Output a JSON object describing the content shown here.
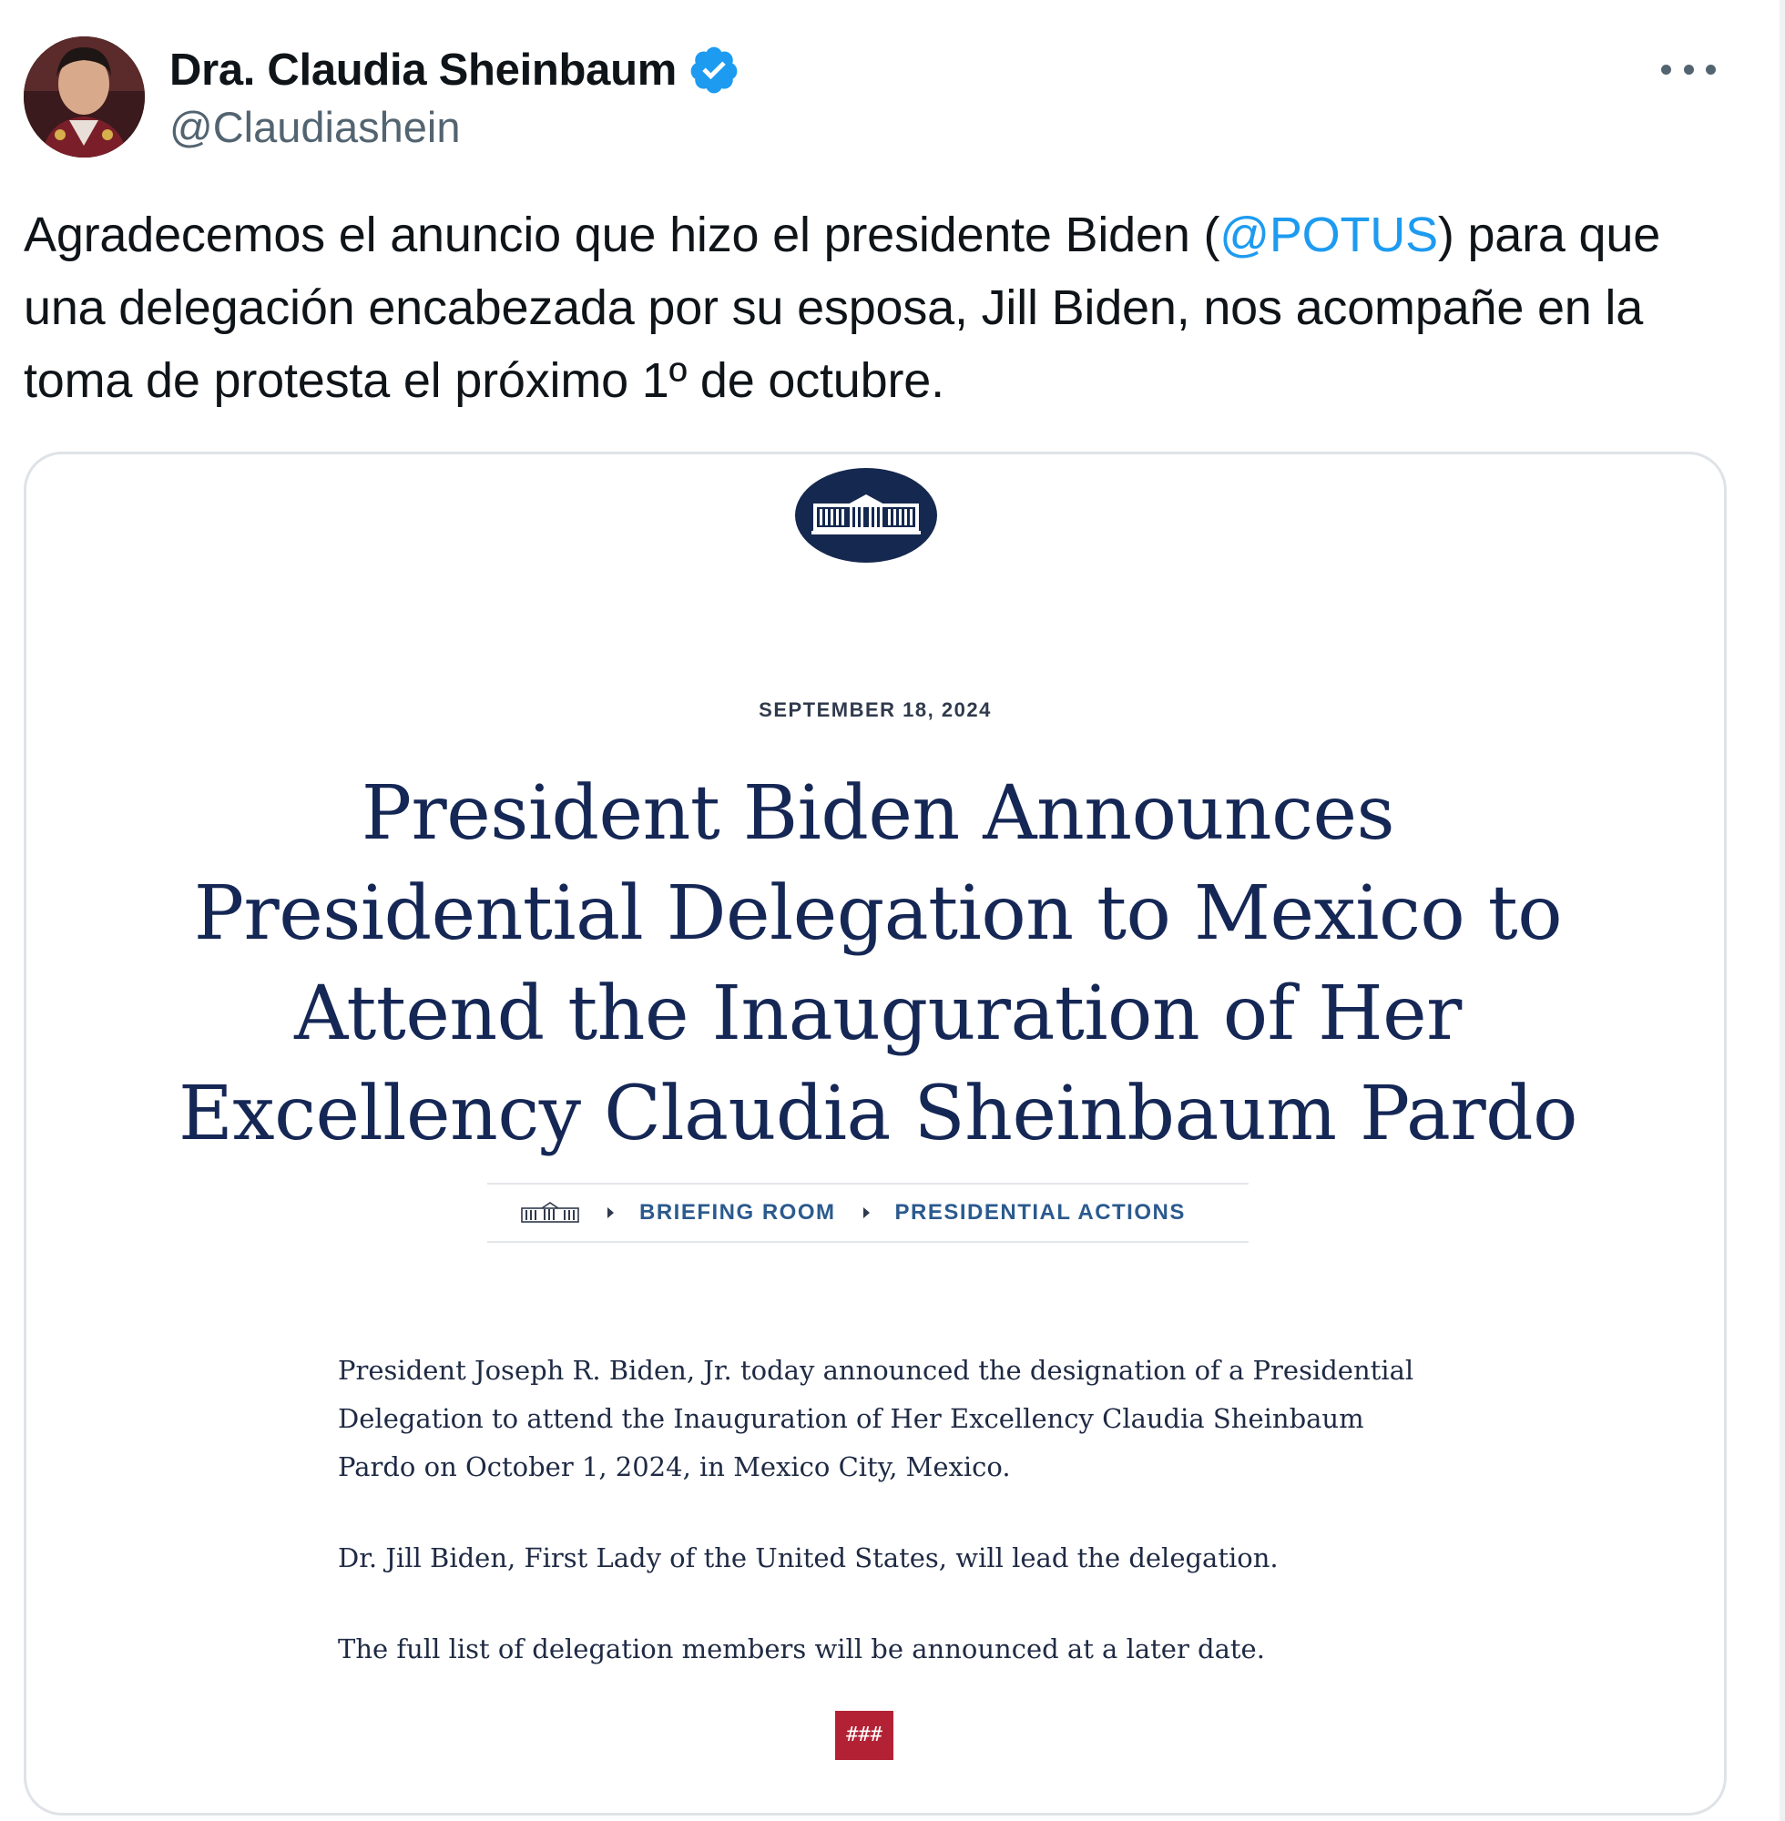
{
  "tweet": {
    "author": {
      "display_name": "Dra. Claudia Sheinbaum",
      "handle": "@Claudiashein",
      "verified": true
    },
    "text": {
      "before_mention": "Agradecemos el anuncio que hizo el presidente Biden (",
      "mention": "@POTUS",
      "after_mention": ") para que una delegación encabezada por su esposa, Jill Biden, nos acompañe en la toma de protesta el próximo 1º de octubre."
    },
    "icons": {
      "more": "more-horizontal-icon",
      "verified": "verified-badge-icon"
    }
  },
  "press_release": {
    "date": "SEPTEMBER 18, 2024",
    "title": "President Biden Announces Presidential Delegation to Mexico to Attend the Inauguration of Her Excellency Claudia Sheinbaum Pardo",
    "breadcrumb": [
      "BRIEFING ROOM",
      "PRESIDENTIAL ACTIONS"
    ],
    "paragraphs": [
      "President Joseph R. Biden, Jr. today announced the designation of a Presidential Delegation to attend the Inauguration of Her Excellency Claudia Sheinbaum Pardo on October 1, 2024, in Mexico City, Mexico.",
      "Dr. Jill Biden, First Lady of the United States, will lead the delegation.",
      "The full list of delegation members will be announced at a later date."
    ],
    "end_mark": "###"
  },
  "colors": {
    "mention_blue": "#1d9bf0",
    "verified_blue": "#1d9bf0",
    "press_navy": "#152755",
    "breadcrumb_blue": "#2b5a8e",
    "end_mark_red": "#b22234"
  }
}
